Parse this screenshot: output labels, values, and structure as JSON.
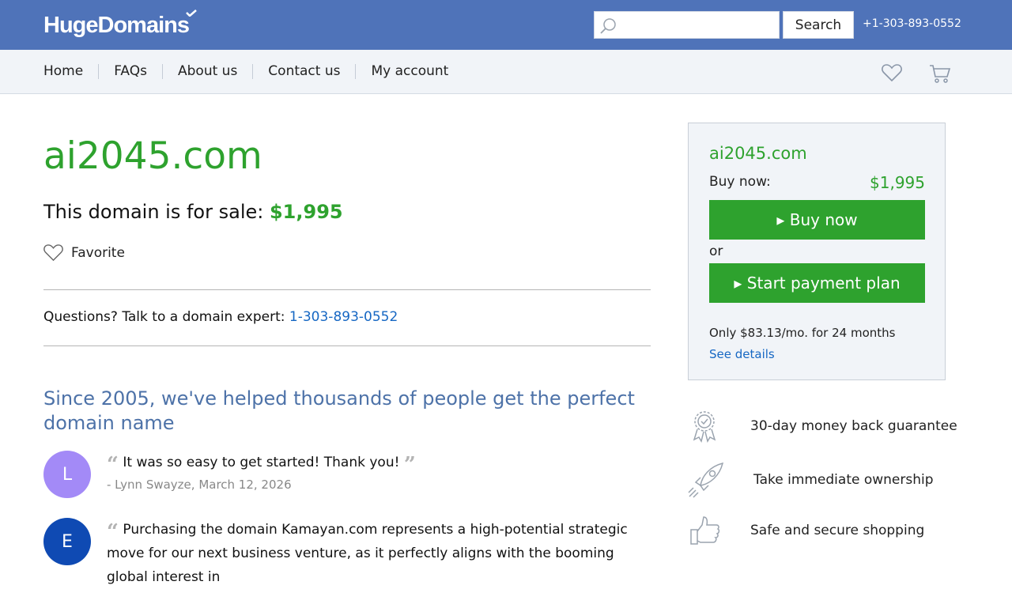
{
  "header": {
    "logo": "HugeDomains",
    "search_placeholder": "",
    "search_button": "Search",
    "phone": "+1-303-893-0552"
  },
  "nav": {
    "items": [
      "Home",
      "FAQs",
      "About us",
      "Contact us",
      "My account"
    ]
  },
  "main": {
    "domain": "ai2045.com",
    "for_sale_text": "This domain is for sale: ",
    "for_sale_price": "$1,995",
    "favorite_label": "Favorite",
    "questions_text": "Questions? Talk to a domain expert: ",
    "questions_phone": "1-303-893-0552",
    "since_heading": "Since 2005, we've helped thousands of people get the perfect domain name",
    "testimonials": [
      {
        "initial": "L",
        "avatar_color": "#a38af7",
        "quote": "It was so easy to get started! Thank you!",
        "author": "- Lynn Swayze, March 12, 2026"
      },
      {
        "initial": "E",
        "avatar_color": "#0f4ab3",
        "quote": "Purchasing the domain Kamayan.com represents a high-potential strategic move for our next business venture, as it perfectly aligns with the booming global interest in",
        "author": ""
      }
    ]
  },
  "buybox": {
    "domain": "ai2045.com",
    "buy_now_label": "Buy now:",
    "price": "$1,995",
    "buy_now_button": "▸ Buy now",
    "or": "or",
    "payment_plan_button": "▸ Start payment plan",
    "monthly_text": "Only $83.13/mo. for 24 months",
    "see_details": "See details"
  },
  "features": [
    {
      "icon": "award-ribbon-icon",
      "label": "30-day money back guarantee"
    },
    {
      "icon": "rocket-icon",
      "label": "Take immediate ownership"
    },
    {
      "icon": "thumbs-up-icon",
      "label": "Safe and secure shopping"
    }
  ],
  "colors": {
    "header_bg": "#4f73b9",
    "accent_green": "#2ea22e",
    "link_blue": "#1667c3",
    "heading_blue": "#4d72a8"
  }
}
